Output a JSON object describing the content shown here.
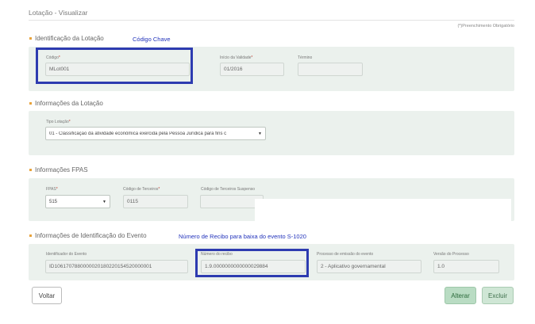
{
  "page": {
    "title": "Lotação - Visualizar",
    "required_note": "(*)Preenchimento Obrigatório"
  },
  "section_identificacao": {
    "heading": "Identificação da Lotação",
    "annotation": "Código Chave",
    "codigo_label": "Código",
    "codigo_value": "MLot001",
    "inicio_label": "Início da Validade",
    "inicio_value": "01/2016",
    "termino_label": "Término",
    "termino_value": ""
  },
  "section_informacoes": {
    "heading": "Informações da Lotação",
    "tipo_label": "Tipo Lotação",
    "tipo_value": "01 - Classificação da atividade econômica exercida pela Pessoa Jurídica para fins c"
  },
  "section_fpas": {
    "heading": "Informações FPAS",
    "fpas_label": "FPAS",
    "fpas_value": "515",
    "terceiros_label": "Código de Terceiros",
    "terceiros_value": "0115",
    "suspenso_label": "Código de Terceiros Suspenso",
    "suspenso_value": ""
  },
  "section_evento": {
    "heading": "Informações de Identificação do Evento",
    "annotation": "Número de Recibo para baixa do evento S-1020",
    "id_label": "Identificador do Evento",
    "id_value": "ID1061707880000020180220154520000001",
    "recibo_label": "Número do recibo",
    "recibo_value": "1.9.0000000000000029884",
    "processo_label": "Processo de emissão do evento",
    "processo_value": "2 - Aplicativo governamental",
    "versao_label": "Versão do Processo",
    "versao_value": "1.0"
  },
  "buttons": {
    "voltar": "Voltar",
    "alterar": "Alterar",
    "excluir": "Excluir"
  },
  "colors": {
    "accent_bullet": "#e8a33c",
    "highlight_box": "#2d3bb0",
    "panel_bg": "#ebf1ed",
    "primary_button": "#b9dcc3"
  }
}
